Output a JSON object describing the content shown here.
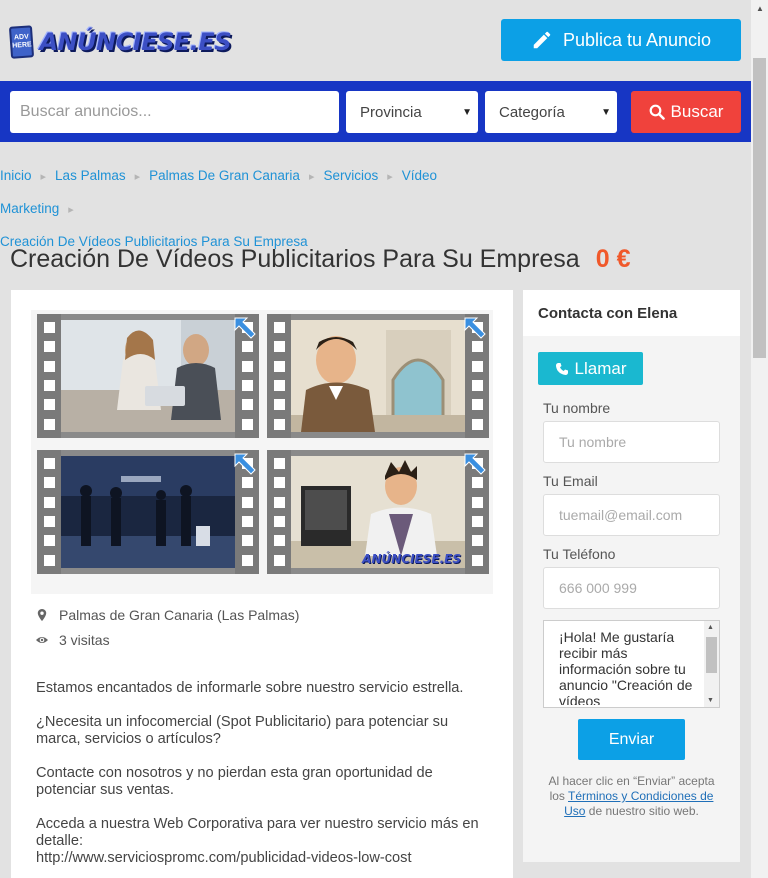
{
  "header": {
    "logo_badge_line1": "ADV",
    "logo_badge_line2": "HERE",
    "logo_text": "ANÚNCIESE.ES",
    "publish_label": "Publica tu Anuncio"
  },
  "search": {
    "placeholder": "Buscar anuncios...",
    "province_label": "Provincia",
    "category_label": "Categoría",
    "button_label": "Buscar"
  },
  "breadcrumb": {
    "items": [
      "Inicio",
      "Las Palmas",
      "Palmas De Gran Canaria",
      "Servicios",
      "Vídeo Marketing"
    ],
    "last": "Creación De Vídeos Publicitarios Para Su Empresa"
  },
  "ad": {
    "title": "Creación De Vídeos Publicitarios Para Su Empresa",
    "price": "0 €",
    "watermark": "ANÚNCIESE.ES",
    "location": "Palmas de Gran Canaria (Las Palmas)",
    "visits": "3 visitas",
    "description": [
      "Estamos encantados de informarle sobre nuestro servicio estrella.",
      "¿Necesita un infocomercial (Spot Publicitario) para potenciar su marca, servicios o artículos?",
      "Contacte con nosotros y no pierdan esta gran oportunidad de potenciar sus ventas.",
      "Acceda a nuestra Web Corporativa para ver nuestro servicio más en detalle:",
      "http://www.serviciospromc.com/publicidad-videos-low-cost"
    ]
  },
  "contact": {
    "heading": "Contacta con Elena",
    "call_label": "Llamar",
    "name_label": "Tu nombre",
    "name_placeholder": "Tu nombre",
    "email_label": "Tu Email",
    "email_placeholder": "tuemail@email.com",
    "phone_label": "Tu Teléfono",
    "phone_placeholder": "666 000 999",
    "message": "¡Hola! Me gustaría recibir más información sobre tu anuncio \"Creación de vídeos",
    "send_label": "Enviar",
    "legal_pre": "Al hacer clic en “Enviar” acepta los ",
    "legal_link": "Términos y Condiciones de Uso",
    "legal_post": " de nuestro sitio web."
  },
  "colors": {
    "accent_blue": "#0ca0e6",
    "search_bar": "#1736c4",
    "search_button": "#f0423c",
    "price": "#f0582a",
    "call_button": "#1ab8d0"
  }
}
